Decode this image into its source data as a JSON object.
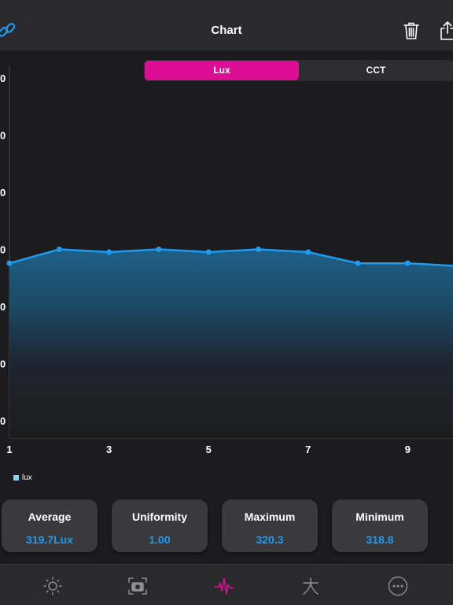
{
  "header": {
    "title": "Chart",
    "icons": [
      "link-icon",
      "trash-icon",
      "share-icon"
    ]
  },
  "segmented": {
    "options": [
      "Lux",
      "CCT"
    ],
    "selected": "Lux"
  },
  "colors": {
    "accent": "#dd0e95",
    "line": "#1e9bf0",
    "value_text": "#1e9bf0",
    "legend_swatch": "#7fd3ff"
  },
  "chart_data": {
    "type": "area",
    "x": [
      1,
      2,
      3,
      4,
      5,
      6,
      7,
      8,
      9,
      10
    ],
    "series": [
      {
        "name": "lux",
        "values": [
          318.8,
          320.3,
          320.0,
          320.3,
          320.0,
          320.3,
          320.0,
          318.8,
          318.8,
          318.5
        ]
      }
    ],
    "xticks": [
      "1",
      "3",
      "5",
      "7",
      "9"
    ],
    "yticks": [
      "0",
      "0",
      "0",
      "0",
      "0",
      "0",
      "0"
    ],
    "ylim": [
      300,
      340
    ],
    "grid": false,
    "legend": "bottom-left"
  },
  "legend": {
    "label": "lux"
  },
  "stats": [
    {
      "label": "Average",
      "value": "319.7Lux"
    },
    {
      "label": "Uniformity",
      "value": "1.00"
    },
    {
      "label": "Maximum",
      "value": "320.3"
    },
    {
      "label": "Minimum",
      "value": "318.8"
    }
  ],
  "tabbar": {
    "items": [
      "sun-icon",
      "camera-icon",
      "pulse-icon",
      "text-size-icon",
      "more-icon"
    ],
    "active": "pulse-icon"
  }
}
